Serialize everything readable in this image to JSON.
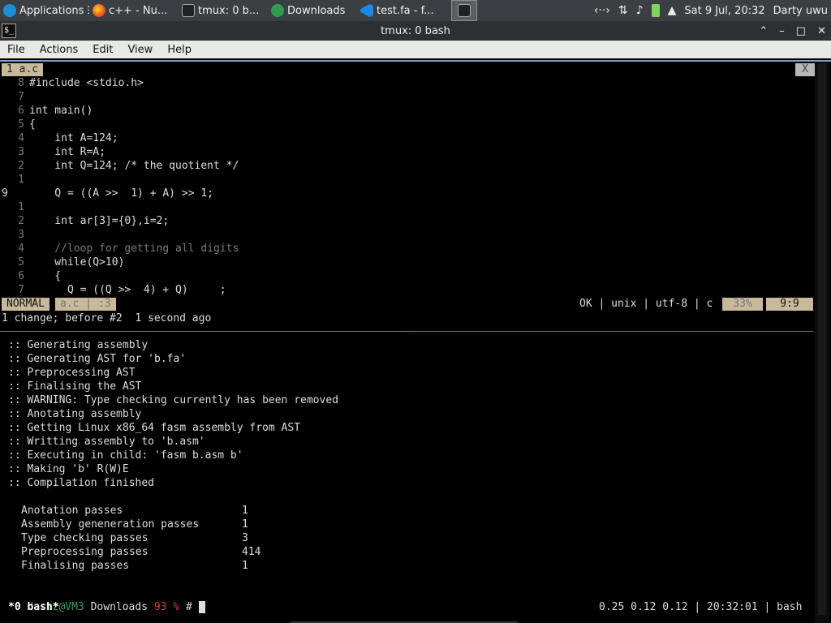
{
  "taskbar": {
    "items": [
      {
        "label": "Applications",
        "icon": "applications-icon"
      },
      {
        "label": "c++ - Nu...",
        "icon": "firefox-icon"
      },
      {
        "label": "tmux: 0 b...",
        "icon": "terminal-icon"
      },
      {
        "label": "Downloads",
        "icon": "downloads-icon"
      },
      {
        "label": "test.fa - f...",
        "icon": "vscode-icon"
      },
      {
        "label": "",
        "icon": "terminal-icon"
      }
    ],
    "apps_separator": "☰",
    "tray": {
      "network": "‹··›",
      "transfer": "⇅",
      "volume": "♪",
      "notification": "▲",
      "clock": "Sat  9 Jul, 20:32",
      "user": "Darty uwu"
    }
  },
  "window": {
    "title": "tmux: 0 bash",
    "minimize": "⌃",
    "restore": "–",
    "maximize": "□",
    "close": "✕"
  },
  "menu": [
    "File",
    "Actions",
    "Edit",
    "View",
    "Help"
  ],
  "vim": {
    "tab_label": "1 a.c",
    "close_label": "X",
    "lines": [
      {
        "n": "8",
        "code": "#include <stdio.h>"
      },
      {
        "n": "7",
        "code": ""
      },
      {
        "n": "6",
        "code": "int main()"
      },
      {
        "n": "5",
        "code": "{"
      },
      {
        "n": "4",
        "code": "    int A=124;"
      },
      {
        "n": "3",
        "code": "    int R=A;"
      },
      {
        "n": "2",
        "code": "    int Q=124; /* the quotient */"
      },
      {
        "n": "1",
        "code": ""
      },
      {
        "n": "9",
        "code": "    Q = ((A >>  1) + A) >> 1;"
      },
      {
        "n": "1",
        "code": ""
      },
      {
        "n": "2",
        "code": "    int ar[3]={0},i=2;"
      },
      {
        "n": "3",
        "code": ""
      },
      {
        "n": "4",
        "code": "    //loop for getting all digits"
      },
      {
        "n": "5",
        "code": "    while(Q>10)"
      },
      {
        "n": "6",
        "code": "    {"
      },
      {
        "n": "7",
        "code": "      Q = ((Q >>  4) + Q)     ;"
      }
    ],
    "mode": "NORMAL",
    "file_info": "a.c | :3",
    "status_right": "OK | unix | utf-8 | c",
    "percent": "33%",
    "position": "9:9",
    "message": "1 change; before #2  1 second ago"
  },
  "shell": {
    "output": [
      ":: Generating assembly",
      ":: Generating AST for 'b.fa'",
      ":: Preprocessing AST",
      ":: Finalising the AST",
      ":: WARNING: Type checking currently has been removed",
      ":: Anotating assembly",
      ":: Getting Linux x86_64 fasm assembly from AST",
      ":: Writting assembly to 'b.asm'",
      ":: Executing in child: 'fasm b.asm b'",
      ":: Making 'b' R(W)E",
      ":: Compilation finished"
    ],
    "stats": [
      {
        "label": "Anotation passes",
        "value": "1"
      },
      {
        "label": "Assembly geneneration passes",
        "value": "1"
      },
      {
        "label": "Type checking passes",
        "value": "3"
      },
      {
        "label": "Preprocessing passes",
        "value": "414"
      },
      {
        "label": "Finalising passes",
        "value": "1"
      }
    ],
    "prompt_user": "dartz@VM3",
    "prompt_dir": "Downloads",
    "prompt_num": "93 %",
    "prompt_sign": "#"
  },
  "tmux": {
    "window": "*0 bash*",
    "status": "0.25 0.12 0.12 | 20:32:01 | bash"
  }
}
